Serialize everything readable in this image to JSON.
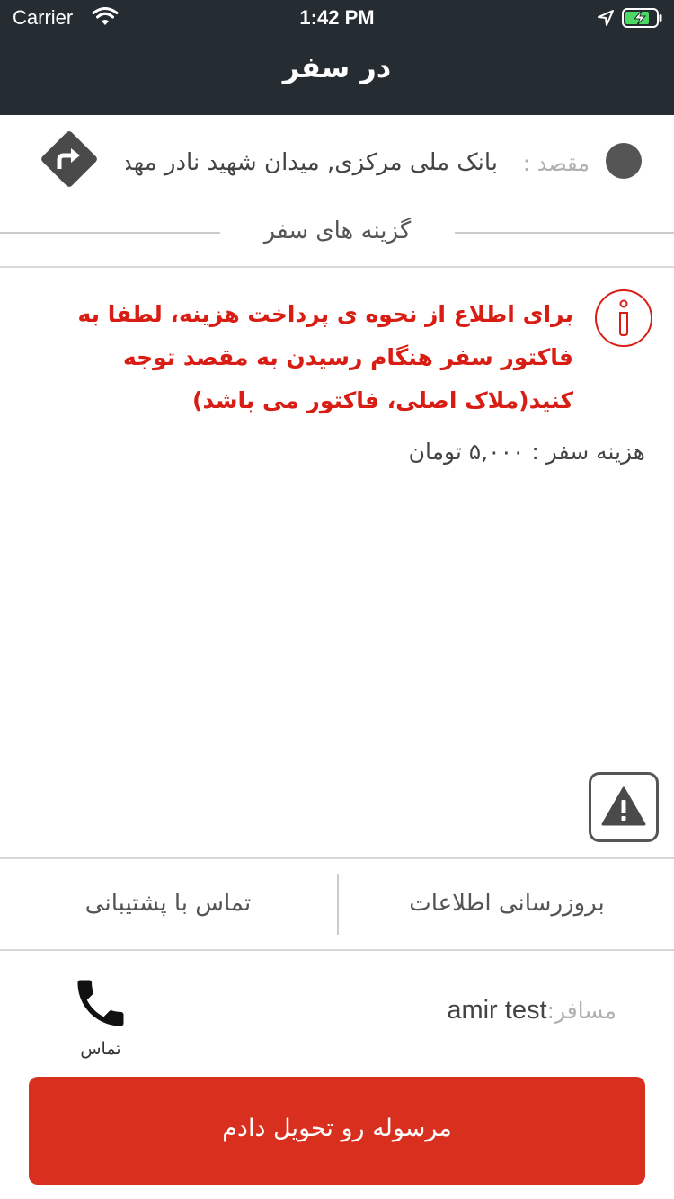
{
  "status_bar": {
    "carrier": "Carrier",
    "time": "1:42 PM"
  },
  "header": {
    "title": "در سفر"
  },
  "destination": {
    "label": "مقصد :",
    "value": "بانک ملی مرکزی, میدان شهید نادر مهد"
  },
  "section": {
    "title": "گزینه های سفر"
  },
  "notice": {
    "text": "برای اطلاع از نحوه ی پرداخت هزینه، لطفا به فاکتور سفر هنگام رسیدن به مقصد توجه کنید(ملاک اصلی، فاکتور می باشد)"
  },
  "fare": {
    "text": "هزینه سفر : ۵,۰۰۰ تومان"
  },
  "tabs": {
    "update_info": "بروزرسانی اطلاعات",
    "contact_support": "تماس با پشتیبانی"
  },
  "passenger": {
    "label": "مسافر:",
    "name": "amir test"
  },
  "call": {
    "label": "تماس"
  },
  "actions": {
    "deliver": "مرسوله رو تحویل دادم"
  },
  "colors": {
    "topbar": "#262d32",
    "notice_red": "#d81e14",
    "primary_button": "#d92f1f"
  },
  "icons": {
    "status": [
      "wifi-icon",
      "location-arrow-icon",
      "battery-charging-icon"
    ],
    "destination": "directions-icon",
    "notice": "info-icon",
    "report": "warning-icon",
    "call": "phone-icon"
  }
}
